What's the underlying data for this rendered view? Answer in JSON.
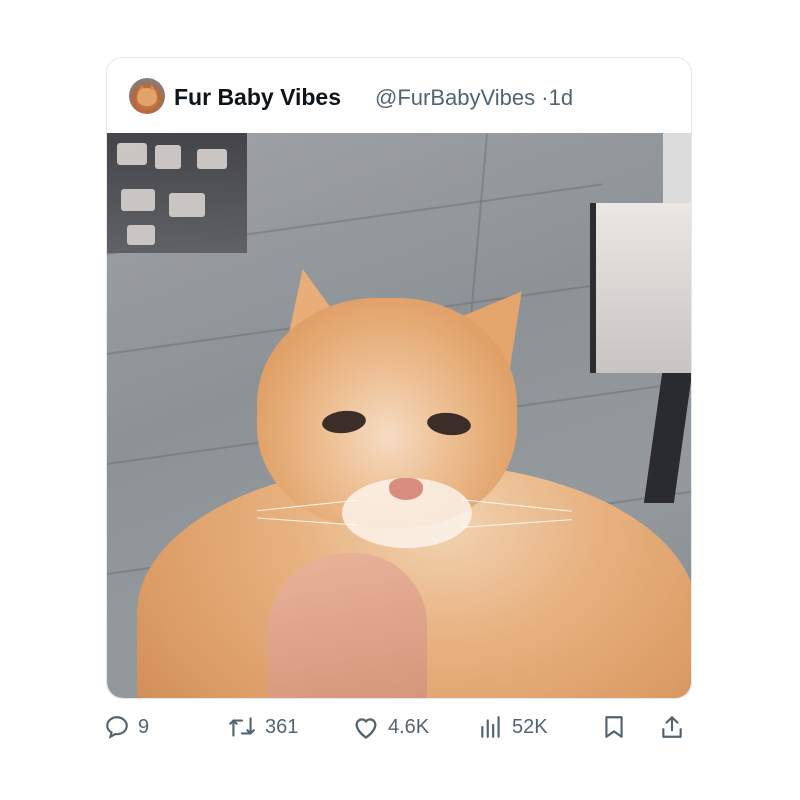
{
  "tweet": {
    "display_name": "Fur Baby Vibes",
    "handle": "@FurBabyVibes",
    "separator": "·",
    "time": "1d",
    "avatar_icon": "cat-avatar-icon",
    "image_alt_icon": "orange-kitten-photo"
  },
  "actions": {
    "replies": "9",
    "reposts": "361",
    "likes": "4.6K",
    "views": "52K"
  },
  "colors": {
    "text_primary": "#0f1419",
    "text_secondary": "#536471",
    "border": "#e6e9ec"
  }
}
